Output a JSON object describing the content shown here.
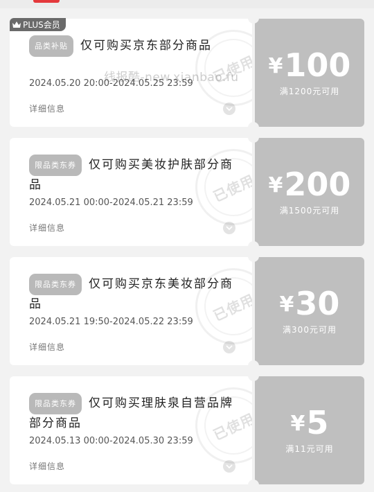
{
  "badge": {
    "label": "PLUS会员"
  },
  "watermark": {
    "text": "线报酷-new.xianbao.fu"
  },
  "coupons": [
    {
      "tag": "品类补贴",
      "title": "仅可购买京东部分商品",
      "dates": "2024.05.20 20:00-2024.05.25 23:59",
      "detail": "详细信息",
      "currency": "¥",
      "amount": "100",
      "condition": "满1200元可用",
      "stamp": "已使用"
    },
    {
      "tag": "限品类东券",
      "title": "仅可购买美妆护肤部分商品",
      "dates": "2024.05.21 00:00-2024.05.21 23:59",
      "detail": "详细信息",
      "currency": "¥",
      "amount": "200",
      "condition": "满1500元可用",
      "stamp": "已使用"
    },
    {
      "tag": "限品类东券",
      "title": "仅可购买京东美妆部分商品",
      "dates": "2024.05.21 19:50-2024.05.22 23:59",
      "detail": "详细信息",
      "currency": "¥",
      "amount": "30",
      "condition": "满300元可用",
      "stamp": "已使用"
    },
    {
      "tag": "限品类东券",
      "title": "仅可购买理肤泉自营品牌部分商品",
      "dates": "2024.05.13 00:00-2024.05.30 23:59",
      "detail": "详细信息",
      "currency": "¥",
      "amount": "5",
      "condition": "满11元可用",
      "stamp": "已使用"
    }
  ]
}
